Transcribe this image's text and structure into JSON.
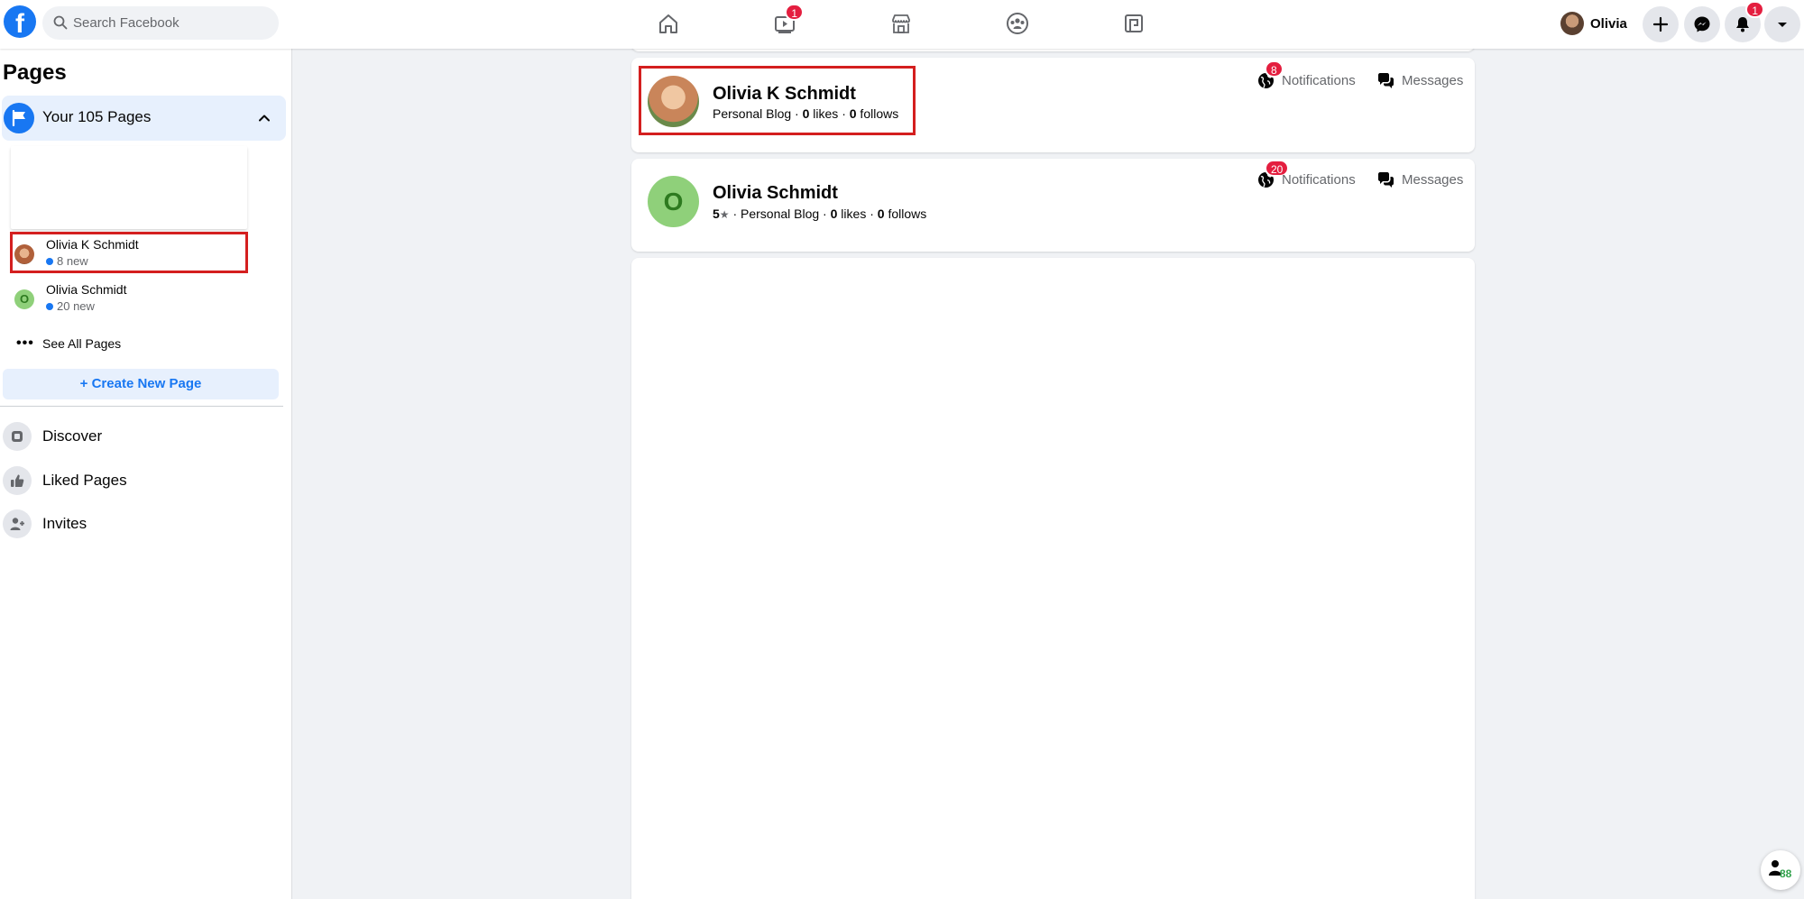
{
  "topbar": {
    "logo": "f",
    "search_placeholder": "Search Facebook",
    "nav": [
      {
        "icon": "home-icon"
      },
      {
        "icon": "watch-icon",
        "badge": "1"
      },
      {
        "icon": "marketplace-icon"
      },
      {
        "icon": "groups-icon"
      },
      {
        "icon": "gaming-icon"
      }
    ],
    "user_name": "Olivia",
    "notifications_badge": "1"
  },
  "sidebar": {
    "title": "Pages",
    "your_pages": "Your 105 Pages",
    "pages": [
      {
        "name": "Olivia K Schmidt",
        "new": "8 new"
      },
      {
        "name": "Olivia Schmidt",
        "new": "20 new",
        "initial": "O"
      }
    ],
    "see_all": "See All Pages",
    "create": "+ Create New Page",
    "links": [
      {
        "label": "Discover",
        "icon": "discover-icon"
      },
      {
        "label": "Liked Pages",
        "icon": "thumbs-up-icon"
      },
      {
        "label": "Invites",
        "icon": "invite-icon"
      }
    ]
  },
  "main": {
    "cards": [
      {
        "name": "Olivia K Schmidt",
        "meta_prefix": "Personal Blog · ",
        "likes": "0",
        "likes_label": " likes · ",
        "follows": "0",
        "follows_label": " follows",
        "notifications_label": "Notifications",
        "notifications_badge": "8",
        "messages_label": "Messages"
      },
      {
        "name": "Olivia Schmidt",
        "initial": "O",
        "rating": "5",
        "meta_prefix": " · Personal Blog · ",
        "likes": "0",
        "likes_label": " likes · ",
        "follows": "0",
        "follows_label": " follows",
        "notifications_label": "Notifications",
        "notifications_badge": "20",
        "messages_label": "Messages"
      }
    ]
  },
  "contacts_fab": {
    "count": "88"
  },
  "colors": {
    "brand": "#1877f2",
    "badge": "#e41e3f",
    "highlight": "#d41f1f",
    "green_avatar": "#8fd07a"
  }
}
